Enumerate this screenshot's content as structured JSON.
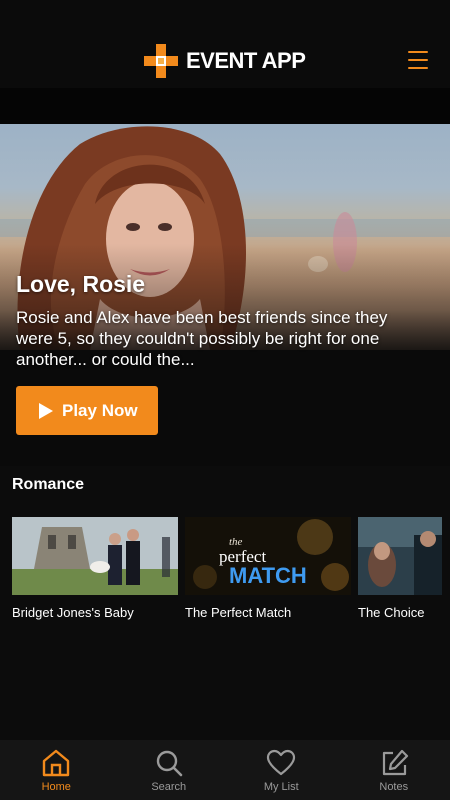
{
  "app": {
    "brand": "EVENT APP"
  },
  "colors": {
    "accent": "#f28a1c",
    "background": "#0c0c0c",
    "tab_inactive": "#9a9a9a"
  },
  "hero": {
    "title": "Love, Rosie",
    "description": "Rosie and Alex have been best friends since they were 5, so they couldn't possibly be right for one another... or could the...",
    "play_label": "Play Now"
  },
  "section": {
    "title": "Romance",
    "items": [
      {
        "label": "Bridget Jones's Baby"
      },
      {
        "label": "The Perfect Match",
        "poster_small": "the",
        "poster_mid": "perfect",
        "poster_big": "MATCH"
      },
      {
        "label": "The Choice"
      }
    ]
  },
  "tabs": [
    {
      "label": "Home",
      "icon": "home-icon",
      "active": true
    },
    {
      "label": "Search",
      "icon": "search-icon",
      "active": false
    },
    {
      "label": "My List",
      "icon": "heart-icon",
      "active": false
    },
    {
      "label": "Notes",
      "icon": "edit-icon",
      "active": false
    }
  ]
}
